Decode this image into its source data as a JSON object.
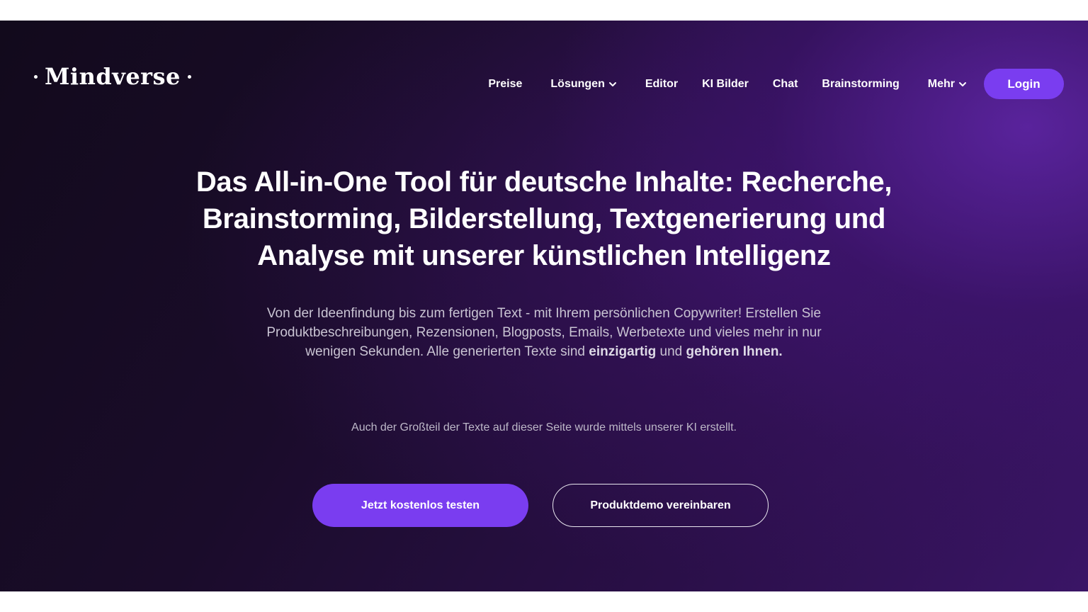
{
  "brand": {
    "name": "Mindverse"
  },
  "nav": {
    "items": [
      {
        "label": "Preise",
        "dropdown": false
      },
      {
        "label": "Lösungen",
        "dropdown": true
      },
      {
        "label": "Editor",
        "dropdown": false
      },
      {
        "label": "KI Bilder",
        "dropdown": false
      },
      {
        "label": "Chat",
        "dropdown": false
      },
      {
        "label": "Brainstorming",
        "dropdown": false
      },
      {
        "label": "Mehr",
        "dropdown": true
      }
    ],
    "login_label": "Login"
  },
  "hero": {
    "headline_lines": [
      "Das All-in-One Tool für deutsche Inhalte: Recherche,",
      "Brainstorming, Bilderstellung, Textgenerierung und",
      "Analyse mit unserer künstlichen Intelligenz"
    ],
    "sub_part1": "Von der Ideenfindung bis zum fertigen Text - mit Ihrem persönlichen Copywriter! Erstellen Sie Produktbeschreibungen, Rezensionen, Blogposts, Emails, Werbetexte und vieles mehr in nur wenigen Sekunden. Alle generierten Texte sind ",
    "sub_bold1": "einzigartig",
    "sub_part2": " und ",
    "sub_bold2": "gehören Ihnen.",
    "note": "Auch der Großteil der Texte auf dieser Seite wurde mittels unserer KI erstellt.",
    "cta_primary": "Jetzt kostenlos testen",
    "cta_secondary": "Produktdemo vereinbaren"
  },
  "colors": {
    "accent": "#7a3df0",
    "background_dark": "#140b20",
    "background_purple": "#3a1566",
    "text_primary": "#ffffff",
    "text_muted": "#c9c4d3"
  },
  "icons": {
    "dropdown": "chevron-down-icon",
    "logo_dots": "dot-icon"
  }
}
